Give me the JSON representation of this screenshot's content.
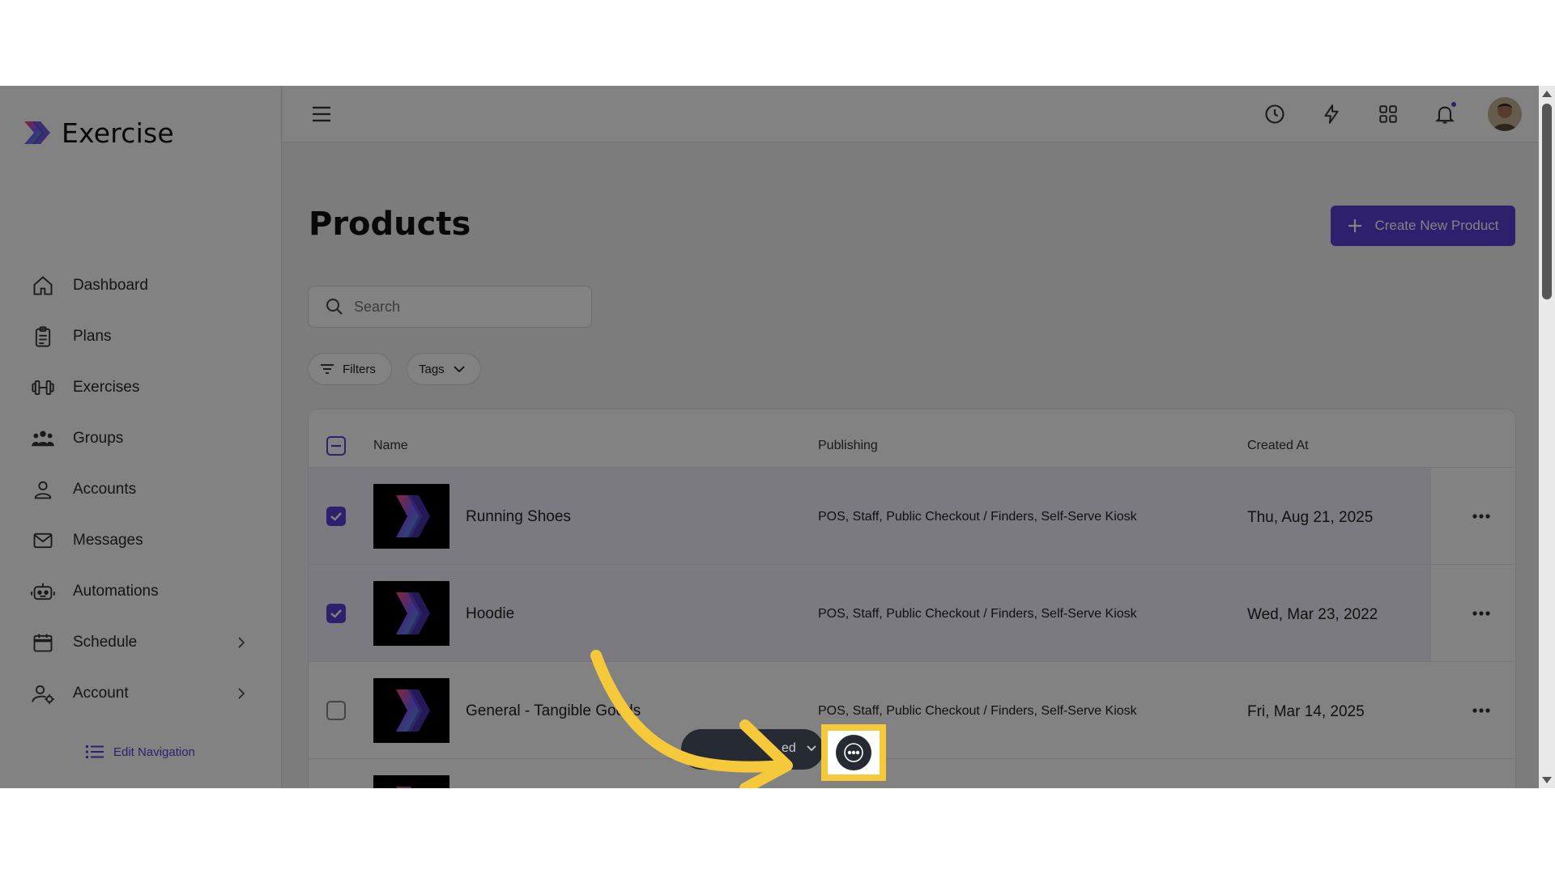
{
  "app": {
    "name": "Exercise"
  },
  "sidebar": {
    "items": [
      {
        "label": "Dashboard",
        "icon": "home-icon"
      },
      {
        "label": "Plans",
        "icon": "clipboard-icon"
      },
      {
        "label": "Exercises",
        "icon": "dumbbell-icon"
      },
      {
        "label": "Groups",
        "icon": "group-icon"
      },
      {
        "label": "Accounts",
        "icon": "user-icon"
      },
      {
        "label": "Messages",
        "icon": "envelope-icon"
      },
      {
        "label": "Automations",
        "icon": "robot-icon"
      },
      {
        "label": "Schedule",
        "icon": "calendar-icon",
        "has_submenu": true
      },
      {
        "label": "Account",
        "icon": "user-settings-icon",
        "has_submenu": true
      }
    ],
    "edit_navigation": "Edit Navigation"
  },
  "topbar": {
    "icons": [
      "menu-icon",
      "clock-icon",
      "lightning-icon",
      "grid-icon",
      "bell-icon"
    ],
    "has_notification": true
  },
  "main": {
    "title": "Products",
    "create_button": "Create New Product",
    "search": {
      "placeholder": "Search",
      "value": ""
    },
    "filters_label": "Filters",
    "tags_label": "Tags",
    "table": {
      "columns": {
        "name": "Name",
        "publishing": "Publishing",
        "created_at": "Created At"
      },
      "rows": [
        {
          "name": "Running Shoes",
          "publishing": "POS, Staff, Public Checkout / Finders, Self-Serve Kiosk",
          "created_at": "Thu, Aug 21, 2025",
          "selected": true
        },
        {
          "name": "Hoodie",
          "publishing": "POS, Staff, Public Checkout / Finders, Self-Serve Kiosk",
          "created_at": "Wed, Mar 23, 2022",
          "selected": true
        },
        {
          "name": "General - Tangible Goods",
          "publishing": "POS, Staff, Public Checkout / Finders, Self-Serve Kiosk",
          "created_at": "Fri, Mar 14, 2025",
          "selected": false
        }
      ]
    }
  },
  "bulk_bar": {
    "label_fragment": "ed"
  },
  "colors": {
    "accent": "#5b3fd6",
    "highlight": "#f6c93b",
    "bar_dark": "#262a33"
  }
}
